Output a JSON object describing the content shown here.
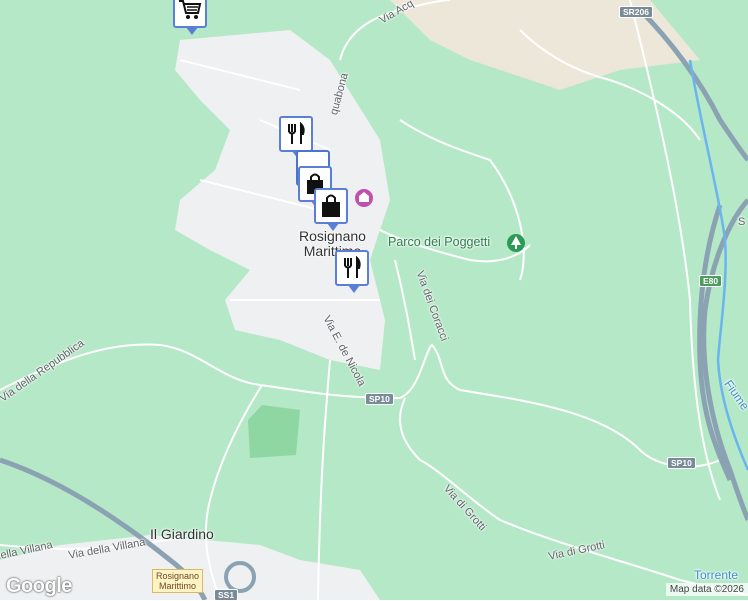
{
  "map": {
    "colors": {
      "land": "#b5e8c7",
      "urban": "#eef0f1",
      "road": "#ffffff",
      "highway": "#8ba2b3",
      "river": "#6ab4f0",
      "park": "#8ed6a2",
      "beige": "#ece7d8"
    }
  },
  "labels": {
    "town": "Rosignano\nMarittimo",
    "park": "Parco dei Poggetti",
    "il_giardino": "Il Giardino",
    "via_acqua": "Via Acq",
    "acquabona": "quabona",
    "via_coracci": "Via dei Coracci",
    "via_nicola": "Via E. de Nicola",
    "via_repubblica": "Via della Repubblica",
    "via_grotti_1": "Via di Grotti",
    "via_grotti_2": "Via di Grotti",
    "via_villana_1": "della Villana",
    "via_villana_2": "Via della Villana",
    "fiume": "Fiume",
    "torrente": "Torrente",
    "right_edge": "S"
  },
  "shields": {
    "sr206": "SR206",
    "sp10_a": "SP10",
    "sp10_b": "SP10",
    "e80": "E80",
    "ss1": "SS1"
  },
  "pois": {
    "station": "Rosignano\nMarittimo"
  },
  "markers": [
    {
      "name": "shopping-cart-marker",
      "icon": "shopping-cart-icon"
    },
    {
      "name": "restaurant-marker-1",
      "icon": "fork-knife-icon"
    },
    {
      "name": "restaurant-marker-2",
      "icon": "fork-knife-icon"
    },
    {
      "name": "shopping-bag-marker-1",
      "icon": "shopping-bag-icon"
    },
    {
      "name": "shopping-bag-marker-2",
      "icon": "shopping-bag-icon"
    },
    {
      "name": "restaurant-marker-3",
      "icon": "fork-knife-icon"
    }
  ],
  "attribution": "Map data ©2026",
  "logo": "Google"
}
